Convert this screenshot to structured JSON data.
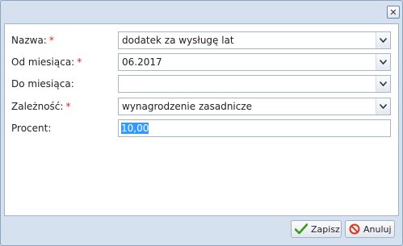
{
  "form": {
    "fields": [
      {
        "label": "Nazwa:",
        "required": true,
        "value": "dodatek za wysługę lat",
        "type": "combo"
      },
      {
        "label": "Od miesiąca:",
        "required": true,
        "value": "06.2017",
        "type": "combo"
      },
      {
        "label": "Do miesiąca:",
        "required": false,
        "value": "",
        "type": "combo"
      },
      {
        "label": "Zależność:",
        "required": true,
        "value": "wynagrodzenie zasadnicze",
        "type": "combo"
      },
      {
        "label": "Procent:",
        "required": false,
        "value": "10,00",
        "type": "text"
      }
    ],
    "required_marker": "*"
  },
  "buttons": {
    "close_icon": "close-icon",
    "save_label": "Zapisz",
    "cancel_label": "Anuluj"
  },
  "colors": {
    "required": "#e02020",
    "selection": "#3399ff",
    "save_icon": "#3a9a1a",
    "cancel_icon": "#d23b20"
  }
}
